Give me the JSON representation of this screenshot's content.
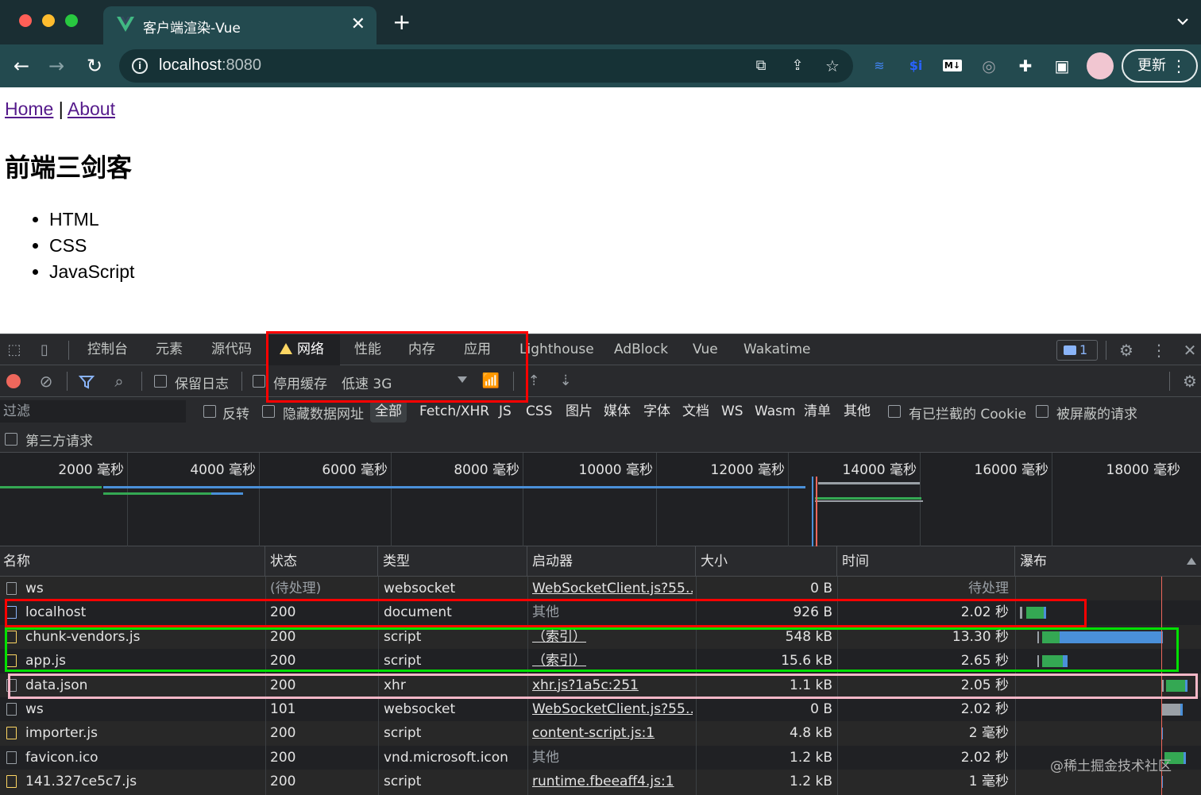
{
  "browser": {
    "tab_title": "客户端渲染-Vue",
    "url_host": "localhost",
    "url_port": ":8080",
    "update_label": "更新",
    "extensions": [
      "translate-icon",
      "share-icon",
      "bookmark-star-icon",
      "layers-extension-icon",
      "dollar-extension-icon",
      "markdown-extension-icon",
      "circle-extension-icon",
      "puzzle-icon",
      "side-panel-icon"
    ],
    "ext_labels": {
      "dollar": "$i",
      "markdown": "M↓"
    }
  },
  "page": {
    "nav_home": "Home",
    "nav_separator": "|",
    "nav_about": "About",
    "title": "前端三剑客",
    "list": [
      "HTML",
      "CSS",
      "JavaScript"
    ]
  },
  "devtools": {
    "tabs": [
      "控制台",
      "元素",
      "源代码",
      "网络",
      "性能",
      "内存",
      "应用",
      "Lighthouse",
      "AdBlock",
      "Vue",
      "Wakatime"
    ],
    "active_tab": "网络",
    "message_count": "1",
    "toolbar": {
      "preserve_log": "保留日志",
      "disable_cache": "停用缓存",
      "throttling": "低速 3G"
    },
    "filter": {
      "placeholder": "过滤",
      "invert": "反转",
      "hide_data_urls": "隐藏数据网址",
      "types": [
        "全部",
        "Fetch/XHR",
        "JS",
        "CSS",
        "图片",
        "媒体",
        "字体",
        "文档",
        "WS",
        "Wasm",
        "清单",
        "其他"
      ],
      "active_type": "全部",
      "blocked_cookies": "有已拦截的 Cookie",
      "blocked_requests": "被屏蔽的请求",
      "third_party": "第三方请求"
    },
    "overview_ticks": [
      "2000 毫秒",
      "4000 毫秒",
      "6000 毫秒",
      "8000 毫秒",
      "10000 毫秒",
      "12000 毫秒",
      "14000 毫秒",
      "16000 毫秒",
      "18000 毫秒"
    ],
    "columns": [
      "名称",
      "状态",
      "类型",
      "启动器",
      "大小",
      "时间",
      "瀑布"
    ],
    "rows": [
      {
        "name": "ws",
        "status": "(待处理)",
        "type": "websocket",
        "initiator": "WebSocketClient.js?55…",
        "size": "0 B",
        "time": "待处理",
        "icon": "generic"
      },
      {
        "name": "localhost",
        "status": "200",
        "type": "document",
        "initiator": "其他",
        "size": "926 B",
        "time": "2.02 秒",
        "icon": "doc"
      },
      {
        "name": "chunk-vendors.js",
        "status": "200",
        "type": "script",
        "initiator": "（索引）",
        "size": "548 kB",
        "time": "13.30 秒",
        "icon": "script"
      },
      {
        "name": "app.js",
        "status": "200",
        "type": "script",
        "initiator": "（索引）",
        "size": "15.6 kB",
        "time": "2.65 秒",
        "icon": "script"
      },
      {
        "name": "data.json",
        "status": "200",
        "type": "xhr",
        "initiator": "xhr.js?1a5c:251",
        "size": "1.1 kB",
        "time": "2.05 秒",
        "icon": "generic"
      },
      {
        "name": "ws",
        "status": "101",
        "type": "websocket",
        "initiator": "WebSocketClient.js?55…",
        "size": "0 B",
        "time": "2.02 秒",
        "icon": "generic"
      },
      {
        "name": "importer.js",
        "status": "200",
        "type": "script",
        "initiator": "content-script.js:1",
        "size": "4.8 kB",
        "time": "2 毫秒",
        "icon": "script"
      },
      {
        "name": "favicon.ico",
        "status": "200",
        "type": "vnd.microsoft.icon",
        "initiator": "其他",
        "size": "1.2 kB",
        "time": "2.02 秒",
        "icon": "generic"
      },
      {
        "name": "141.327ce5c7.js",
        "status": "200",
        "type": "script",
        "initiator": "runtime.fbeeaff4.js:1",
        "size": "1.2 kB",
        "time": "1 毫秒",
        "icon": "script"
      }
    ]
  },
  "watermark": "@稀土掘金技术社区",
  "colors": {
    "highlight_red": "#ff0000",
    "highlight_green": "#00e000",
    "highlight_pink": "#f6b8c8",
    "waterfall_green": "#34a853",
    "waterfall_blue": "#4a90d9"
  }
}
